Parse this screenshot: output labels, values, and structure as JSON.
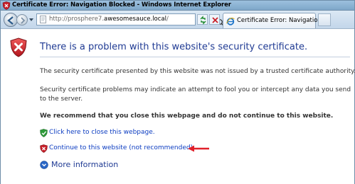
{
  "window": {
    "title": "Certificate Error: Navigation Blocked - Windows Internet Explorer"
  },
  "toolbar": {
    "address_prefix": "http://prosphere7.",
    "address_host": "awesomesauce.local",
    "address_suffix": "/",
    "tab_label": "Certificate Error: Navigation ..."
  },
  "page": {
    "heading": "There is a problem with this website's security certificate.",
    "paragraph1": "The security certificate presented by this website was not issued by a trusted certificate authority.",
    "paragraph2": "Security certificate problems may indicate an attempt to fool you or intercept any data you send to the server.",
    "recommendation": "We recommend that you close this webpage and do not continue to this website.",
    "close_link": "Click here to close this webpage.",
    "continue_link": "Continue to this website (not recommended).",
    "more_info": "More information"
  },
  "colors": {
    "heading": "#1f3a93",
    "link": "#0b3cc1",
    "arrow": "#e0202a",
    "shield": "#c8202a"
  }
}
